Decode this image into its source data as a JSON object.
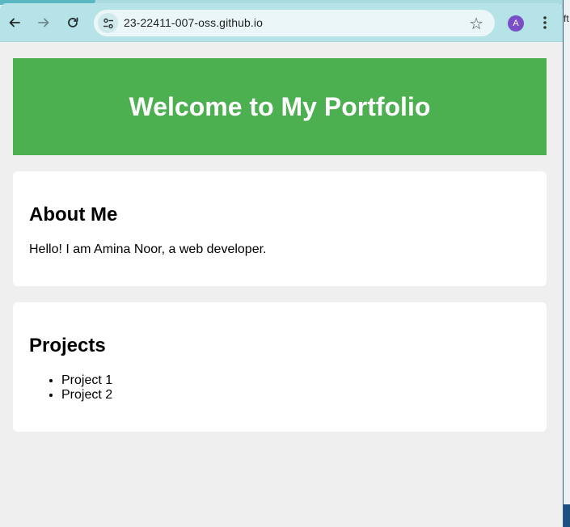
{
  "browser": {
    "url": "23-22411-007-oss.github.io",
    "profile_initial": "A",
    "icons": {
      "back": "back-arrow-icon",
      "forward": "forward-arrow-icon",
      "reload": "reload-icon",
      "site_info": "tune-icon",
      "bookmark": "star-icon",
      "menu": "kebab-menu-icon"
    }
  },
  "page": {
    "banner_title": "Welcome to My Portfolio",
    "about": {
      "heading": "About Me",
      "text": "Hello! I am Amina Noor, a web developer."
    },
    "projects": {
      "heading": "Projects",
      "items": [
        "Project 1",
        "Project 2"
      ]
    }
  },
  "desktop": {
    "edge_text": "ft"
  },
  "colors": {
    "banner": "#4caf50",
    "toolbar": "#b6e3e8",
    "page_background": "#efefef",
    "avatar": "#7a4ec6"
  }
}
